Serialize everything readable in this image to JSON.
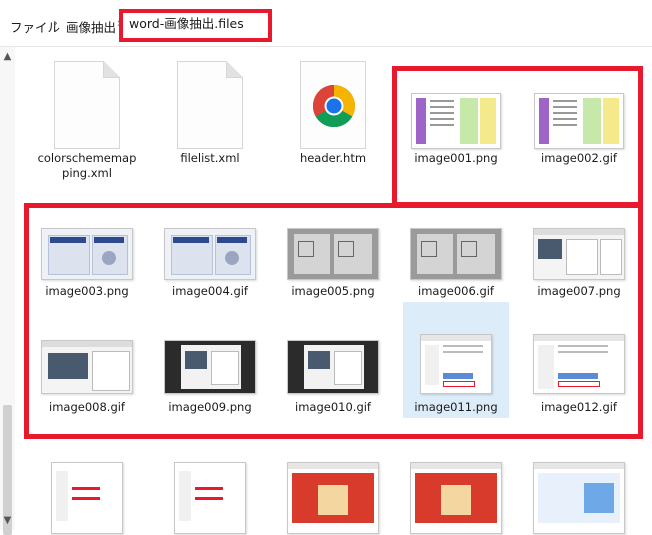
{
  "breadcrumb": {
    "items": [
      "ファイル",
      "画像抽出"
    ],
    "current": "word-画像抽出.files",
    "separator": "›"
  },
  "scroll": {
    "up_arrow": "▲",
    "down_arrow": "▼"
  },
  "accent_colors": {
    "highlight_red": "#e8192c",
    "selection_blue": "#dcecf9"
  },
  "files": [
    {
      "name": "colorschememapping.xml",
      "line1": "colorschememap",
      "line2": "ping.xml",
      "icon": "xml-file-icon"
    },
    {
      "name": "filelist.xml",
      "line1": "filelist.xml",
      "icon": "xml-file-icon"
    },
    {
      "name": "header.htm",
      "line1": "header.htm",
      "icon": "chrome-html-icon"
    },
    {
      "name": "image001.png",
      "line1": "image001.png",
      "icon": "image-thumbnail"
    },
    {
      "name": "image002.gif",
      "line1": "image002.gif",
      "icon": "image-thumbnail"
    },
    {
      "name": "image003.png",
      "line1": "image003.png",
      "icon": "image-thumbnail"
    },
    {
      "name": "image004.gif",
      "line1": "image004.gif",
      "icon": "image-thumbnail"
    },
    {
      "name": "image005.png",
      "line1": "image005.png",
      "icon": "image-thumbnail"
    },
    {
      "name": "image006.gif",
      "line1": "image006.gif",
      "icon": "image-thumbnail"
    },
    {
      "name": "image007.png",
      "line1": "image007.png",
      "icon": "image-thumbnail"
    },
    {
      "name": "image008.gif",
      "line1": "image008.gif",
      "icon": "image-thumbnail"
    },
    {
      "name": "image009.png",
      "line1": "image009.png",
      "icon": "image-thumbnail"
    },
    {
      "name": "image010.gif",
      "line1": "image010.gif",
      "icon": "image-thumbnail"
    },
    {
      "name": "image011.png",
      "line1": "image011.png",
      "icon": "image-thumbnail",
      "selected": true
    },
    {
      "name": "image012.gif",
      "line1": "image012.gif",
      "icon": "image-thumbnail"
    }
  ]
}
